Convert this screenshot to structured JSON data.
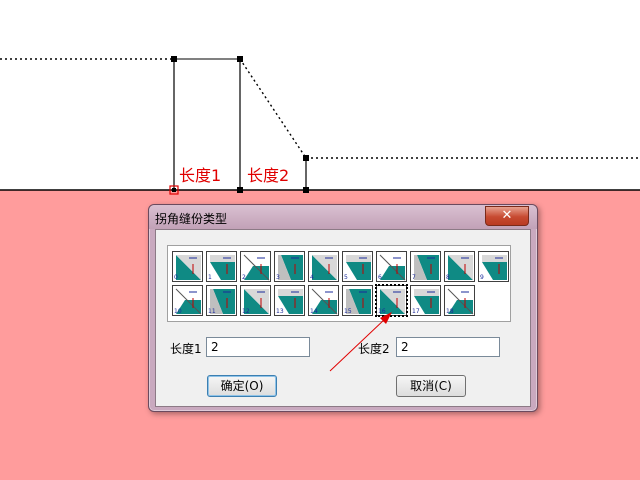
{
  "drawing": {
    "label_length1": "长度1",
    "label_length2": "长度2",
    "accent": "#e00000",
    "lower_area_color": "#ff9c9c"
  },
  "dialog": {
    "title": "拐角缝份类型",
    "close_symbol": "✕",
    "icons": [
      {
        "num": "0"
      },
      {
        "num": "1"
      },
      {
        "num": "2"
      },
      {
        "num": "3"
      },
      {
        "num": "4"
      },
      {
        "num": "5"
      },
      {
        "num": "6"
      },
      {
        "num": "7"
      },
      {
        "num": "8"
      },
      {
        "num": "9"
      },
      {
        "num": "10"
      },
      {
        "num": "11"
      },
      {
        "num": "12"
      },
      {
        "num": "13"
      },
      {
        "num": "14"
      },
      {
        "num": "15"
      },
      {
        "num": "16",
        "selected": true
      },
      {
        "num": "17"
      },
      {
        "num": "18"
      }
    ],
    "length1": {
      "label": "长度1",
      "value": "2"
    },
    "length2": {
      "label": "长度2",
      "value": "2"
    },
    "ok_label": "确定(O)",
    "cancel_label": "取消(C)"
  }
}
